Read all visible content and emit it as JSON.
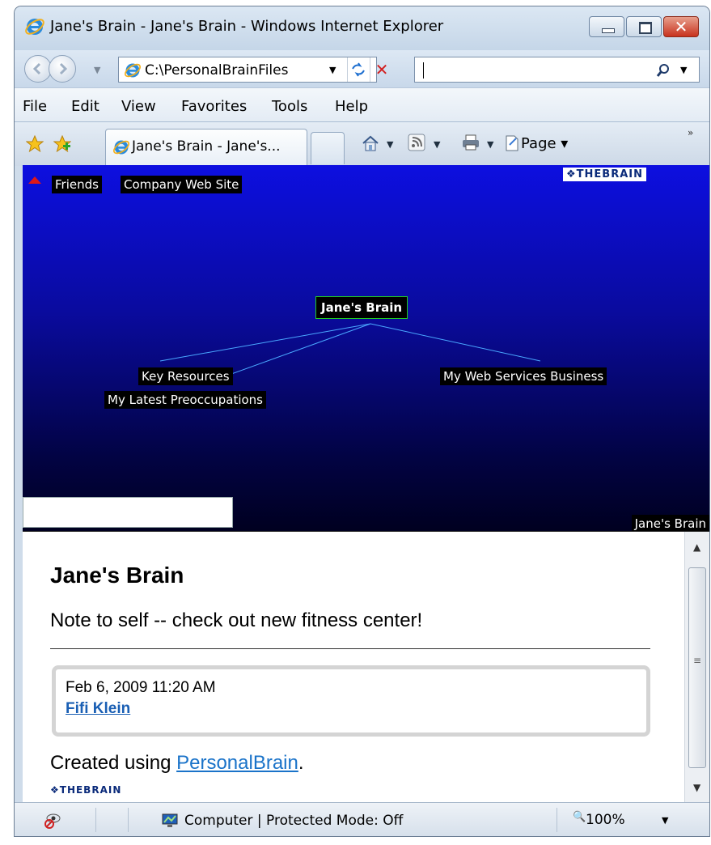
{
  "window": {
    "title": "Jane's Brain - Jane's Brain - Windows Internet Explorer",
    "controls": {
      "minimize": "minimize",
      "maximize": "maximize",
      "close": "✕"
    }
  },
  "address_bar": {
    "value": "C:\\PersonalBrainFiles"
  },
  "search_bar": {
    "value": ""
  },
  "menu": [
    "File",
    "Edit",
    "View",
    "Favorites",
    "Tools",
    "Help"
  ],
  "tabs": {
    "active_title": "Jane's Brain - Jane's..."
  },
  "toolbar": {
    "page_label": "Page ▾",
    "chevrons": "»"
  },
  "brain": {
    "parents": [
      "Friends",
      "Company Web Site"
    ],
    "logo": "❖THEBRAIN",
    "active_thought": "Jane's Brain",
    "children": [
      "Key Resources",
      "My Latest Preoccupations",
      "My Web Services Business"
    ],
    "status_label": "Jane's Brain",
    "search_value": ""
  },
  "content": {
    "title": "Jane's Brain",
    "note": "Note to self -- check out new fitness center!",
    "date": "Feb 6, 2009 11:20 AM",
    "author": "Fifi Klein",
    "created_prefix": "Created using ",
    "created_link": "PersonalBrain",
    "created_suffix": ".",
    "logo": "❖THEBRAIN"
  },
  "status_bar": {
    "zone": "Computer | Protected Mode: Off",
    "zoom": "100%"
  },
  "colors": {
    "brain_bg_top": "#0d0fe0",
    "brain_bg_bottom": "#000020",
    "active_border": "#22cc22",
    "link_line": "#4aa8ff",
    "link_text": "#1a73c9"
  }
}
